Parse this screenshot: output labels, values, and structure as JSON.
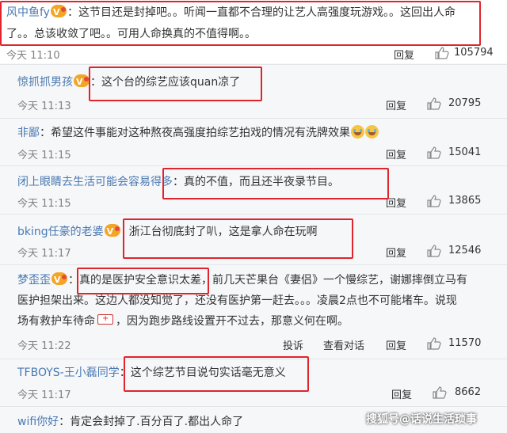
{
  "comments": [
    {
      "user": "风中鱼fy",
      "badge": "vip",
      "sep": "：",
      "lines": [
        "这节目还是封掉吧。。听闻一直都不合理的让艺人高强度玩游戏。。这回出人命",
        "了。。总该收敛了吧。。可用人命换真的不值得啊。。"
      ],
      "time": "今天 11:10",
      "reply": "回复",
      "likes": "105794"
    },
    {
      "user": "惊抓抓男孩",
      "badge": "vip",
      "sep": "：",
      "lines": [
        "这个台的综艺应该quan凉了"
      ],
      "time": "今天 11:13",
      "reply": "回复",
      "likes": "20795"
    },
    {
      "user": "非鄙",
      "sep": "：",
      "lines": [
        "希望这件事能对这种熬夜高强度拍综艺拍戏的情况有洗牌效果"
      ],
      "time": "今天 11:15",
      "reply": "回复",
      "likes": "15041",
      "emoji": "crying-face"
    },
    {
      "user": "闭上眼睛去生活可能会容易得多",
      "sep": "：",
      "lines": [
        "真的不值，而且还半夜录节目。"
      ],
      "time": "今天 11:15",
      "reply": "回复",
      "likes": "13865"
    },
    {
      "user": "bking任豪的老婆",
      "badge": "vip",
      "sep": "：",
      "lines": [
        "浙江台彻底封了叭，这是拿人命在玩啊"
      ],
      "time": "今天 11:17",
      "reply": "回复",
      "likes": "12546"
    },
    {
      "user": "梦歪歪",
      "badge": "vip",
      "sep": "：",
      "lines": [
        "真的是医护安全意识太差，前几天芒果台《妻侣》一个慢综艺，谢娜摔倒立马有",
        "医护担架出来。这边人都没知觉了，还没有医护第一赶去。。。凌晨2点也不可能堵车。说现",
        "场有救护车待命",
        "，因为跑步路线设置开不过去，那意义何在啊。"
      ],
      "time": "今天 11:22",
      "report": "投诉",
      "view": "查看对话",
      "reply": "回复",
      "likes": "11570"
    },
    {
      "user": "TFBOYS-王小磊同学",
      "sep": "：",
      "lines": [
        "这个综艺节目说句实话毫无意义"
      ],
      "time": "今天 11:17",
      "reply": "回复",
      "likes": "8662"
    },
    {
      "user": "wifi你好",
      "sep": "：",
      "lines": [
        "肯定会封掉了.百分百了.都出人命了"
      ]
    }
  ],
  "watermark": "搜狐号@话说生活琐事",
  "colors": {
    "username": "#4a79b1",
    "highlight": "#e0242b",
    "background": "#f6f7f9"
  }
}
